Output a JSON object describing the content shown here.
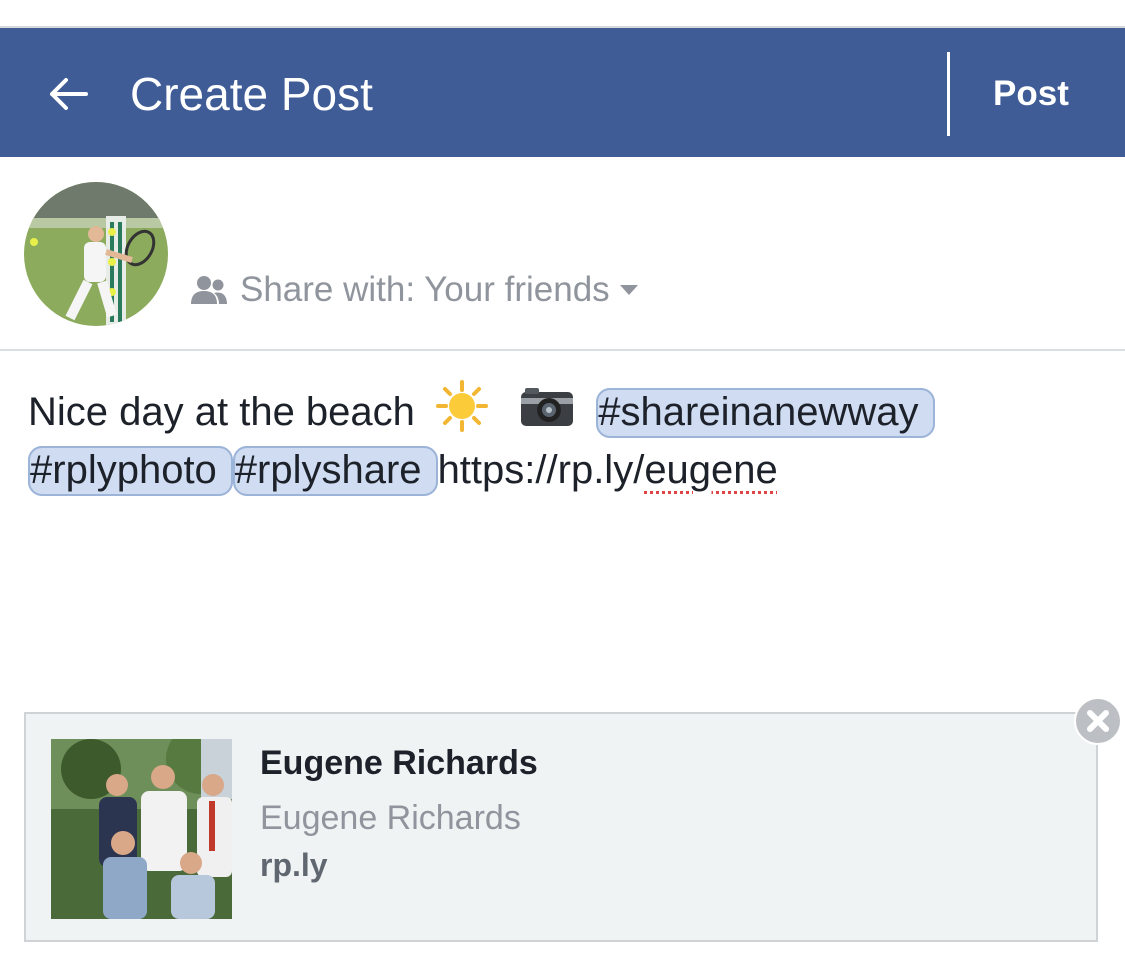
{
  "header": {
    "title": "Create Post",
    "post_label": "Post",
    "back_icon": "arrow-left-icon",
    "color": "#3f5c97"
  },
  "audience": {
    "label": "Share with: Your friends",
    "icon": "people-icon",
    "caret_icon": "caret-down-icon"
  },
  "composer": {
    "text_before": "Nice day at the beach",
    "emoji_1": "sun-emoji",
    "emoji_2": "camera-emoji",
    "hashtags": [
      "#shareinanewway",
      "#rplyphoto",
      "#rplyshare"
    ],
    "url_prefix": "https://rp.ly/",
    "url_word": "eugene"
  },
  "link_preview": {
    "title": "Eugene Richards",
    "subtitle": "Eugene Richards",
    "domain": "rp.ly",
    "close_icon": "close-icon"
  }
}
